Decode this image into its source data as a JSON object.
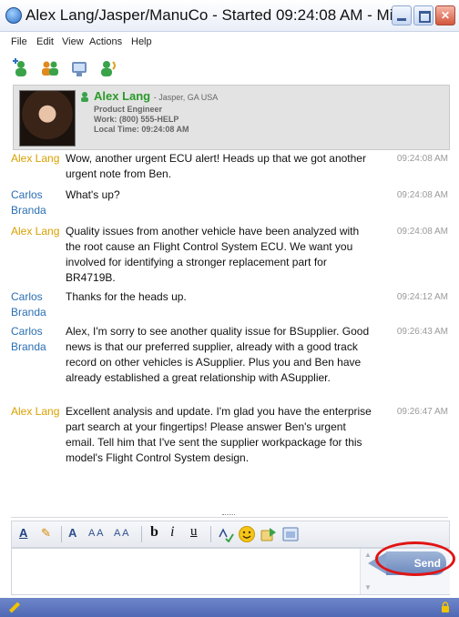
{
  "window": {
    "title": "Alex Lang/Jasper/ManuCo - Started 09:24:08 AM - Mi..."
  },
  "menu": [
    "File",
    "Edit",
    "View",
    "Actions",
    "Help"
  ],
  "toolbar_icons": [
    "add-contact-icon",
    "group-chat-icon",
    "meeting-icon",
    "call-icon"
  ],
  "profile": {
    "name": "Alex Lang",
    "location": "- Jasper, GA USA",
    "title": "Product Engineer",
    "work": "Work: (800) 555-HELP",
    "local_time": "Local Time: 09:24:08 AM"
  },
  "messages": [
    {
      "sender": "Alex Lang",
      "time": "09:24:08 AM",
      "text": "Wow, another urgent ECU alert!  Heads up that we got another urgent note from Ben."
    },
    {
      "sender": "Carlos Branda",
      "time": "09:24:08 AM",
      "text": "What's up?"
    },
    {
      "sender": "Alex Lang",
      "time": "09:24:08 AM",
      "text": "Quality issues from another vehicle have been analyzed with the root cause an Flight Control System ECU.  We want you involved for identifying a stronger replacement part for BR4719B."
    },
    {
      "sender": "Carlos Branda",
      "time": "09:24:12 AM",
      "text": "Thanks for the heads up."
    },
    {
      "sender": "Carlos Branda",
      "time": "09:26:43 AM",
      "text": "Alex, I'm sorry to see another quality issue for BSupplier.  Good news is that our preferred supplier, already with a good track record on other vehicles is ASupplier.  Plus you and Ben have already established a great relationship with ASupplier."
    },
    {
      "sender": "Alex Lang",
      "time": "09:26:47 AM",
      "text": "Excellent analysis and update.  I'm glad you have the enterprise part search at your fingertips!  Please answer Ben's urgent email.  Tell him that I've sent the supplier workpackage for this model's Flight Control System design."
    }
  ],
  "format_toolbar": {
    "font_color": "A",
    "highlight": "✎",
    "font": "A",
    "grow": "A A",
    "shrink": "A A",
    "bold": "b",
    "italic": "i",
    "underline": "u"
  },
  "compose": {
    "value": ""
  },
  "send_label": "Send",
  "colors": {
    "alex": "#d9a000",
    "carlos": "#2a6fb3",
    "status_bar": "#5a72bd",
    "highlight_circle": "#e01414"
  }
}
